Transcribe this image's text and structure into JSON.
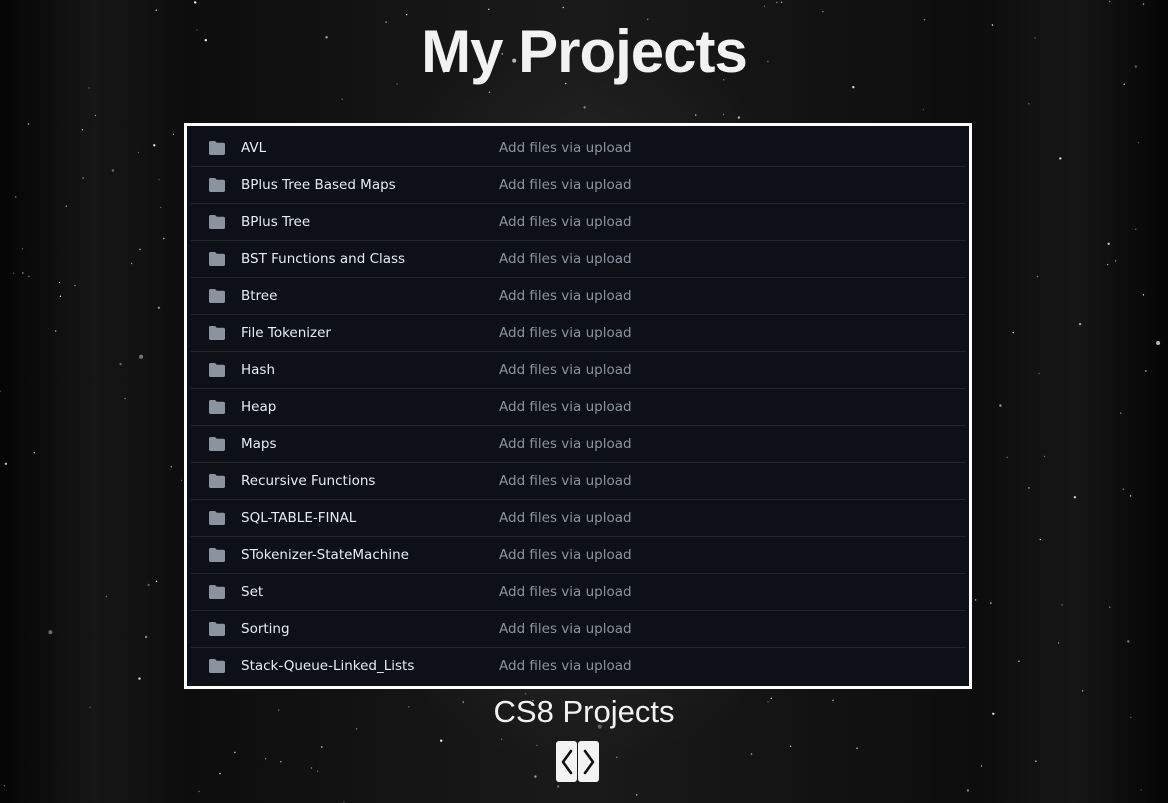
{
  "page": {
    "title": "My Projects",
    "subtitle": "CS8 Projects"
  },
  "repo_listing": {
    "rows": [
      {
        "name": "AVL",
        "message": "Add files via upload",
        "icon": "folder-icon"
      },
      {
        "name": "BPlus Tree Based Maps",
        "message": "Add files via upload",
        "icon": "folder-icon"
      },
      {
        "name": "BPlus Tree",
        "message": "Add files via upload",
        "icon": "folder-icon"
      },
      {
        "name": "BST Functions and Class",
        "message": "Add files via upload",
        "icon": "folder-icon"
      },
      {
        "name": "Btree",
        "message": "Add files via upload",
        "icon": "folder-icon"
      },
      {
        "name": "File Tokenizer",
        "message": "Add files via upload",
        "icon": "folder-icon"
      },
      {
        "name": "Hash",
        "message": "Add files via upload",
        "icon": "folder-icon"
      },
      {
        "name": "Heap",
        "message": "Add files via upload",
        "icon": "folder-icon"
      },
      {
        "name": "Maps",
        "message": "Add files via upload",
        "icon": "folder-icon"
      },
      {
        "name": "Recursive Functions",
        "message": "Add files via upload",
        "icon": "folder-icon"
      },
      {
        "name": "SQL-TABLE-FINAL",
        "message": "Add files via upload",
        "icon": "folder-icon"
      },
      {
        "name": "STokenizer-StateMachine",
        "message": "Add files via upload",
        "icon": "folder-icon"
      },
      {
        "name": "Set",
        "message": "Add files via upload",
        "icon": "folder-icon"
      },
      {
        "name": "Sorting",
        "message": "Add files via upload",
        "icon": "folder-icon"
      },
      {
        "name": "Stack-Queue-Linked_Lists",
        "message": "Add files via upload",
        "icon": "folder-icon"
      }
    ]
  },
  "carousel_nav": {
    "prev_icon": "chevron-left-icon",
    "next_icon": "chevron-right-icon"
  },
  "colors": {
    "listing_background": "#0d1117",
    "folder_icon": "#8b949e",
    "name_text": "#e6edf3",
    "message_text": "#8b949e",
    "frame_border": "#ffffff"
  }
}
